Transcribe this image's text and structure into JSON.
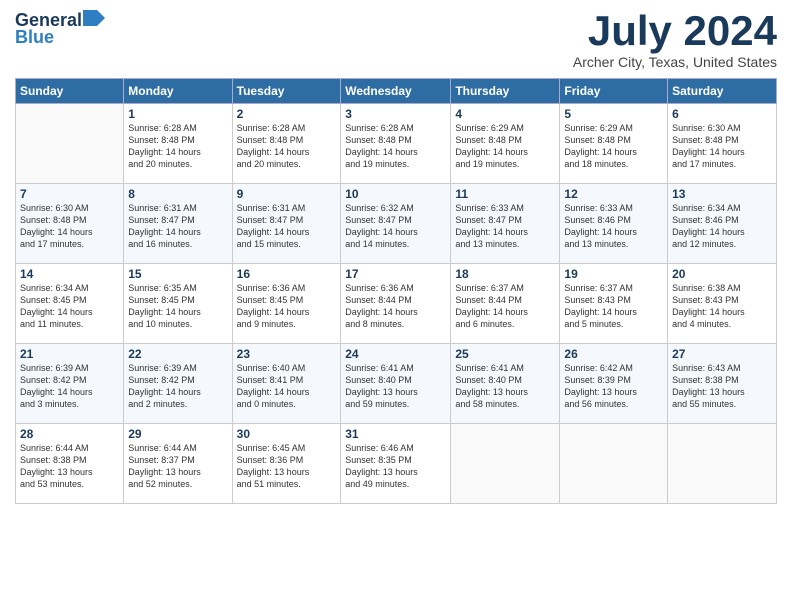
{
  "logo": {
    "general": "General",
    "blue": "Blue"
  },
  "title": "July 2024",
  "location": "Archer City, Texas, United States",
  "days_header": [
    "Sunday",
    "Monday",
    "Tuesday",
    "Wednesday",
    "Thursday",
    "Friday",
    "Saturday"
  ],
  "weeks": [
    [
      {
        "day": "",
        "info": ""
      },
      {
        "day": "1",
        "info": "Sunrise: 6:28 AM\nSunset: 8:48 PM\nDaylight: 14 hours\nand 20 minutes."
      },
      {
        "day": "2",
        "info": "Sunrise: 6:28 AM\nSunset: 8:48 PM\nDaylight: 14 hours\nand 20 minutes."
      },
      {
        "day": "3",
        "info": "Sunrise: 6:28 AM\nSunset: 8:48 PM\nDaylight: 14 hours\nand 19 minutes."
      },
      {
        "day": "4",
        "info": "Sunrise: 6:29 AM\nSunset: 8:48 PM\nDaylight: 14 hours\nand 19 minutes."
      },
      {
        "day": "5",
        "info": "Sunrise: 6:29 AM\nSunset: 8:48 PM\nDaylight: 14 hours\nand 18 minutes."
      },
      {
        "day": "6",
        "info": "Sunrise: 6:30 AM\nSunset: 8:48 PM\nDaylight: 14 hours\nand 17 minutes."
      }
    ],
    [
      {
        "day": "7",
        "info": "Sunrise: 6:30 AM\nSunset: 8:48 PM\nDaylight: 14 hours\nand 17 minutes."
      },
      {
        "day": "8",
        "info": "Sunrise: 6:31 AM\nSunset: 8:47 PM\nDaylight: 14 hours\nand 16 minutes."
      },
      {
        "day": "9",
        "info": "Sunrise: 6:31 AM\nSunset: 8:47 PM\nDaylight: 14 hours\nand 15 minutes."
      },
      {
        "day": "10",
        "info": "Sunrise: 6:32 AM\nSunset: 8:47 PM\nDaylight: 14 hours\nand 14 minutes."
      },
      {
        "day": "11",
        "info": "Sunrise: 6:33 AM\nSunset: 8:47 PM\nDaylight: 14 hours\nand 13 minutes."
      },
      {
        "day": "12",
        "info": "Sunrise: 6:33 AM\nSunset: 8:46 PM\nDaylight: 14 hours\nand 13 minutes."
      },
      {
        "day": "13",
        "info": "Sunrise: 6:34 AM\nSunset: 8:46 PM\nDaylight: 14 hours\nand 12 minutes."
      }
    ],
    [
      {
        "day": "14",
        "info": "Sunrise: 6:34 AM\nSunset: 8:45 PM\nDaylight: 14 hours\nand 11 minutes."
      },
      {
        "day": "15",
        "info": "Sunrise: 6:35 AM\nSunset: 8:45 PM\nDaylight: 14 hours\nand 10 minutes."
      },
      {
        "day": "16",
        "info": "Sunrise: 6:36 AM\nSunset: 8:45 PM\nDaylight: 14 hours\nand 9 minutes."
      },
      {
        "day": "17",
        "info": "Sunrise: 6:36 AM\nSunset: 8:44 PM\nDaylight: 14 hours\nand 8 minutes."
      },
      {
        "day": "18",
        "info": "Sunrise: 6:37 AM\nSunset: 8:44 PM\nDaylight: 14 hours\nand 6 minutes."
      },
      {
        "day": "19",
        "info": "Sunrise: 6:37 AM\nSunset: 8:43 PM\nDaylight: 14 hours\nand 5 minutes."
      },
      {
        "day": "20",
        "info": "Sunrise: 6:38 AM\nSunset: 8:43 PM\nDaylight: 14 hours\nand 4 minutes."
      }
    ],
    [
      {
        "day": "21",
        "info": "Sunrise: 6:39 AM\nSunset: 8:42 PM\nDaylight: 14 hours\nand 3 minutes."
      },
      {
        "day": "22",
        "info": "Sunrise: 6:39 AM\nSunset: 8:42 PM\nDaylight: 14 hours\nand 2 minutes."
      },
      {
        "day": "23",
        "info": "Sunrise: 6:40 AM\nSunset: 8:41 PM\nDaylight: 14 hours\nand 0 minutes."
      },
      {
        "day": "24",
        "info": "Sunrise: 6:41 AM\nSunset: 8:40 PM\nDaylight: 13 hours\nand 59 minutes."
      },
      {
        "day": "25",
        "info": "Sunrise: 6:41 AM\nSunset: 8:40 PM\nDaylight: 13 hours\nand 58 minutes."
      },
      {
        "day": "26",
        "info": "Sunrise: 6:42 AM\nSunset: 8:39 PM\nDaylight: 13 hours\nand 56 minutes."
      },
      {
        "day": "27",
        "info": "Sunrise: 6:43 AM\nSunset: 8:38 PM\nDaylight: 13 hours\nand 55 minutes."
      }
    ],
    [
      {
        "day": "28",
        "info": "Sunrise: 6:44 AM\nSunset: 8:38 PM\nDaylight: 13 hours\nand 53 minutes."
      },
      {
        "day": "29",
        "info": "Sunrise: 6:44 AM\nSunset: 8:37 PM\nDaylight: 13 hours\nand 52 minutes."
      },
      {
        "day": "30",
        "info": "Sunrise: 6:45 AM\nSunset: 8:36 PM\nDaylight: 13 hours\nand 51 minutes."
      },
      {
        "day": "31",
        "info": "Sunrise: 6:46 AM\nSunset: 8:35 PM\nDaylight: 13 hours\nand 49 minutes."
      },
      {
        "day": "",
        "info": ""
      },
      {
        "day": "",
        "info": ""
      },
      {
        "day": "",
        "info": ""
      }
    ]
  ]
}
